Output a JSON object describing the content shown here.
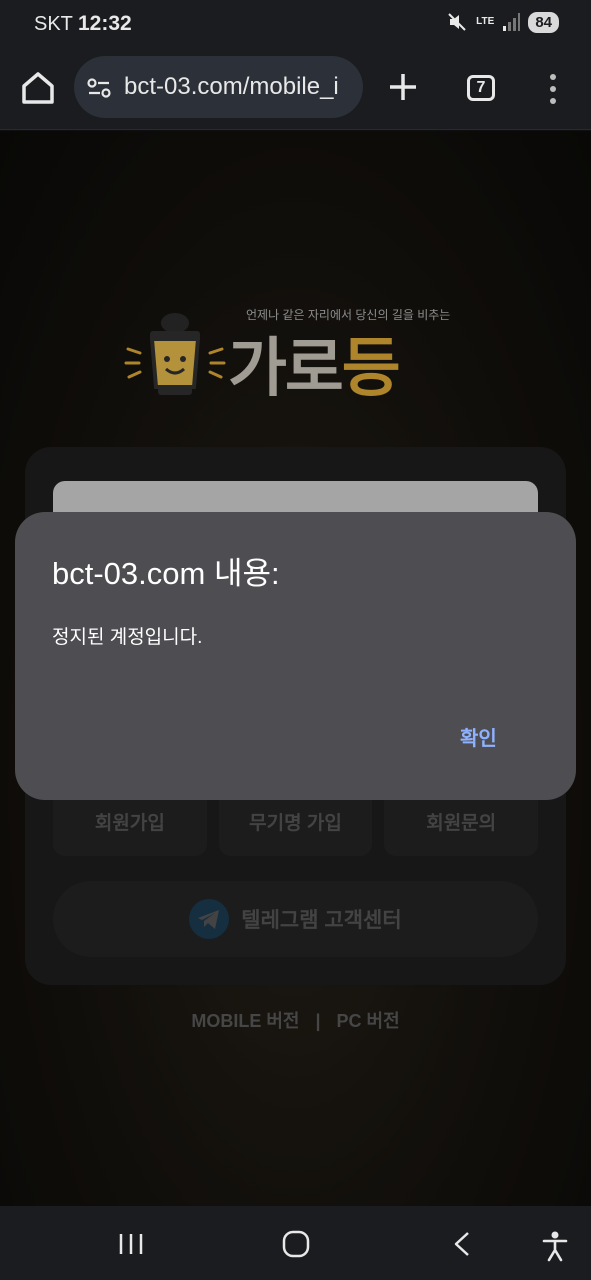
{
  "status_bar": {
    "carrier": "SKT",
    "time": "12:32",
    "network": "LTE",
    "battery": "84"
  },
  "browser": {
    "url": "bct-03.com/mobile_i",
    "tab_count": "7"
  },
  "page": {
    "logo_tagline": "언제나 같은 자리에서 당신의 길을 비추는",
    "logo_main": "가로",
    "logo_accent": "등",
    "buttons": [
      "회원가입",
      "무기명 가입",
      "회원문의"
    ],
    "telegram_label": "텔레그램 고객센터",
    "mobile_version": "MOBILE 버전",
    "separator": "|",
    "pc_version": "PC 버전"
  },
  "dialog": {
    "title": "bct-03.com 내용:",
    "message": "정지된 계정입니다.",
    "ok_label": "확인"
  },
  "colors": {
    "dialog_bg": "#4d4d52",
    "ok_accent": "#8fb2ff",
    "logo_accent": "#e9b23a"
  }
}
